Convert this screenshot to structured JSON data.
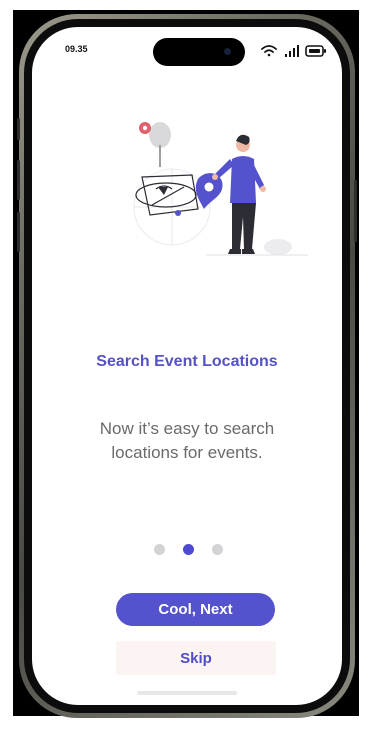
{
  "status_bar": {
    "time": "09.35"
  },
  "onboarding": {
    "title": "Search Event Locations",
    "description": "Now it’s easy to search locations for events.",
    "page_count": 3,
    "active_page": 2
  },
  "actions": {
    "next_label": "Cool, Next",
    "skip_label": "Skip"
  },
  "colors": {
    "accent": "#5452cc",
    "title": "#5452c6",
    "dot_inactive": "#d3d3d6",
    "skip_background": "#fcf4f3"
  },
  "icons": [
    "wifi-icon",
    "signal-icon",
    "battery-icon",
    "location-pin-icon"
  ]
}
